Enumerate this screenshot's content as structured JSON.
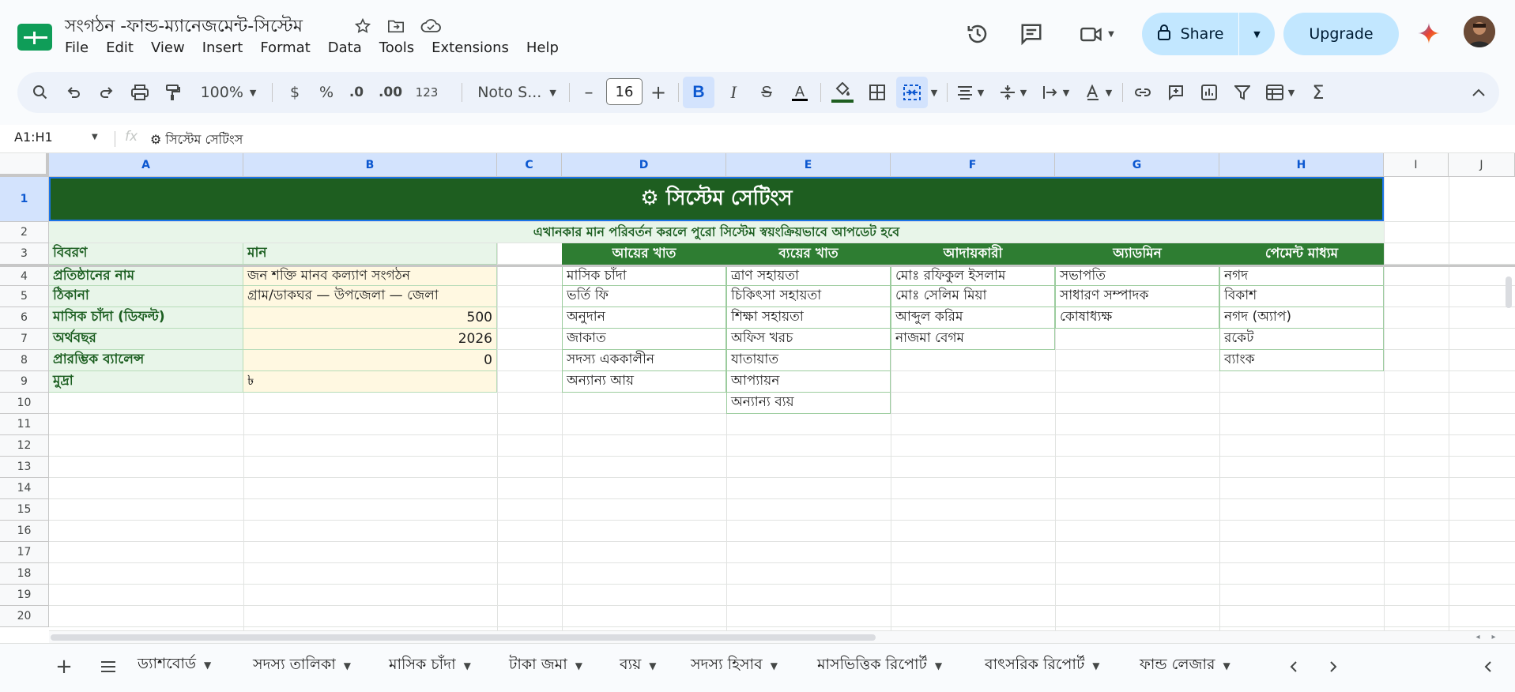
{
  "app": {
    "doc_title": "সংগঠন -ফান্ড-ম্যানেজমেন্ট-সিস্টেম",
    "menu": [
      "File",
      "Edit",
      "View",
      "Insert",
      "Format",
      "Data",
      "Tools",
      "Extensions",
      "Help"
    ],
    "share_label": "Share",
    "upgrade_label": "Upgrade"
  },
  "toolbar": {
    "zoom": "100%",
    "currency": "$",
    "percent": "%",
    "dec_decrease": ".0",
    "dec_increase": ".00",
    "number_format": "123",
    "font": "Noto S...",
    "font_size": "16",
    "minus": "–",
    "plus": "+"
  },
  "formula_bar": {
    "name_box": "A1:H1",
    "fx": "fx",
    "content": "⚙ সিস্টেম সেটিংস"
  },
  "columns": [
    "A",
    "B",
    "C",
    "D",
    "E",
    "F",
    "G",
    "H",
    "I",
    "J"
  ],
  "rows": [
    "1",
    "2",
    "3",
    "4",
    "5",
    "6",
    "7",
    "8",
    "9",
    "10",
    "11",
    "12",
    "13",
    "14",
    "15",
    "16",
    "17",
    "18",
    "19",
    "20"
  ],
  "sheet": {
    "banner": "⚙ সিস্টেম সেটিংস",
    "subtitle": "এখানকার মান পরিবর্তন করলে পুরো সিস্টেম স্বয়ংক্রিয়ভাবে আপডেট হবে",
    "settings_header": {
      "desc": "বিবরণ",
      "value": "মান"
    },
    "settings": [
      {
        "label": "প্রতিষ্ঠানের নাম",
        "value": "জন শক্তি মানব কল্যাণ সংগঠন",
        "align": "left"
      },
      {
        "label": "ঠিকানা",
        "value": "গ্রাম/ডাকঘর — উপজেলা — জেলা",
        "align": "left"
      },
      {
        "label": "মাসিক চাঁদা (ডিফল্ট)",
        "value": "500",
        "align": "right"
      },
      {
        "label": "অর্থবছর",
        "value": "2026",
        "align": "right"
      },
      {
        "label": "প্রারম্ভিক ব্যালেন্স",
        "value": "0",
        "align": "right"
      },
      {
        "label": "মুদ্রা",
        "value": "৳",
        "align": "left"
      }
    ],
    "lists": [
      {
        "header": "আয়ের খাত",
        "items": [
          "মাসিক চাঁদা",
          "ভর্তি ফি",
          "অনুদান",
          "জাকাত",
          "সদস্য এককালীন",
          "অন্যান্য আয়"
        ]
      },
      {
        "header": "ব্যয়ের খাত",
        "items": [
          "ত্রাণ সহায়তা",
          "চিকিৎসা সহায়তা",
          "শিক্ষা সহায়তা",
          "অফিস খরচ",
          "যাতায়াত",
          "আপ্যায়ন",
          "অন্যান্য ব্যয়"
        ]
      },
      {
        "header": "আদায়কারী",
        "items": [
          "মোঃ রফিকুল ইসলাম",
          "মোঃ সেলিম মিয়া",
          "আব্দুল করিম",
          "নাজমা বেগম"
        ]
      },
      {
        "header": "অ্যাডমিন",
        "items": [
          "সভাপতি",
          "সাধারণ সম্পাদক",
          "কোষাধ্যক্ষ"
        ]
      },
      {
        "header": "পেমেন্ট মাধ্যম",
        "items": [
          "নগদ",
          "বিকাশ",
          "নগদ (অ্যাপ)",
          "রকেট",
          "ব্যাংক"
        ]
      }
    ]
  },
  "tabs": [
    "ড্যাশবোর্ড",
    "সদস্য তালিকা",
    "মাসিক চাঁদা",
    "টাকা জমা",
    "ব্যয়",
    "সদস্য হিসাব",
    "মাসভিত্তিক রিপোর্ট",
    "বাৎসরিক রিপোর্ট",
    "ফান্ড লেজার"
  ],
  "colors": {
    "header_green": "#1e5e20",
    "list_header": "#2e7d32",
    "label_bg": "#e8f5e9",
    "value_bg": "#fff8e1",
    "share_bg": "#c2e7ff"
  }
}
